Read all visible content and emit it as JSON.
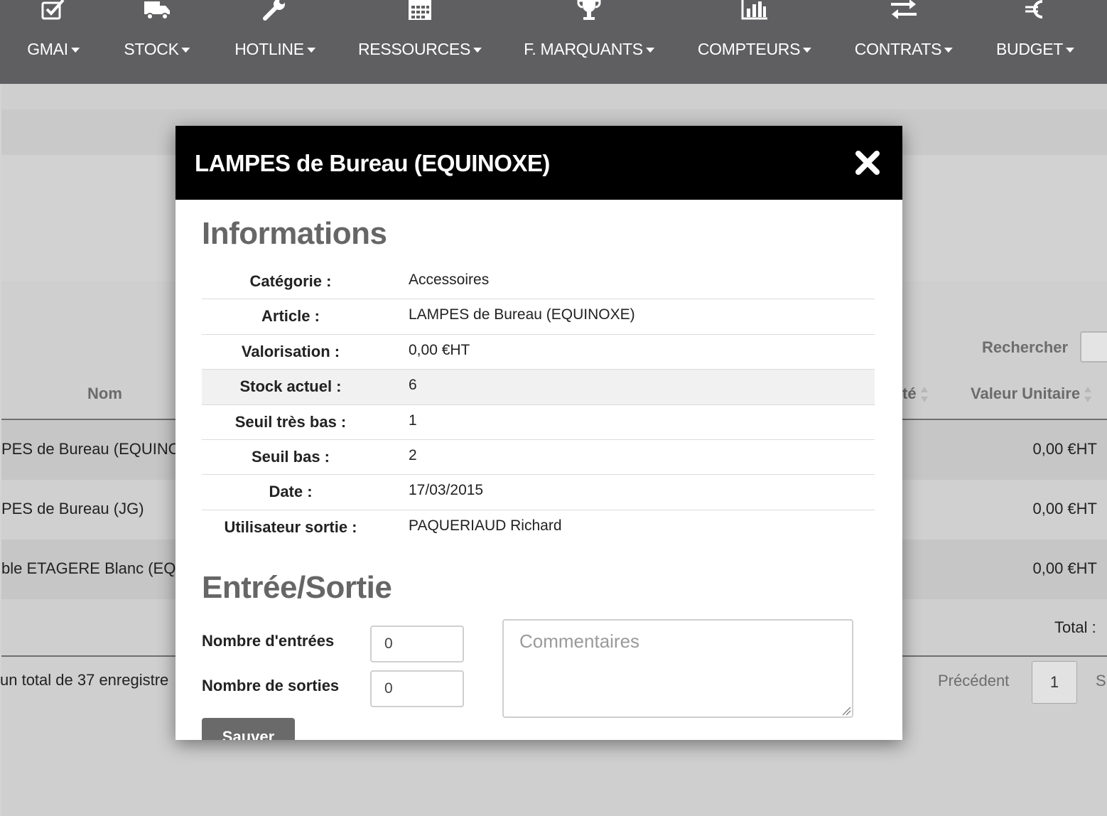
{
  "nav": {
    "items": [
      {
        "label": "GMAI",
        "icon": "checkbox-icon"
      },
      {
        "label": "STOCK",
        "icon": "truck-icon"
      },
      {
        "label": "HOTLINE",
        "icon": "wrench-icon"
      },
      {
        "label": "RESSOURCES",
        "icon": "calendar-icon"
      },
      {
        "label": "F. MARQUANTS",
        "icon": "trophy-icon"
      },
      {
        "label": "COMPTEURS",
        "icon": "bar-chart-icon"
      },
      {
        "label": "CONTRATS",
        "icon": "exchange-icon"
      },
      {
        "label": "BUDGET",
        "icon": "euro-icon"
      }
    ]
  },
  "background": {
    "search_label": "Rechercher",
    "columns": {
      "nom": "Nom",
      "qte_partial": "té",
      "valeur_unitaire": "Valeur Unitaire"
    },
    "rows": [
      {
        "name": "PES de Bureau (EQUINO",
        "value": "0,00 €HT"
      },
      {
        "name": "PES de Bureau (JG)",
        "value": "0,00 €HT"
      },
      {
        "name": "ble ETAGERE Blanc (EQU",
        "value": "0,00 €HT"
      }
    ],
    "total_label": "Total :",
    "footer_text": "un total de 37 enregistre",
    "pagination": {
      "previous": "Précédent",
      "current_page": "1",
      "next_partial": "S"
    }
  },
  "modal": {
    "title": "LAMPES de Bureau (EQUINOXE)",
    "close_glyph": "✖",
    "info_section_title": "Informations",
    "info": [
      {
        "label": "Catégorie :",
        "value": "Accessoires"
      },
      {
        "label": "Article :",
        "value": "LAMPES de Bureau (EQUINOXE)"
      },
      {
        "label": "Valorisation :",
        "value": "0,00 €HT"
      },
      {
        "label": "Stock actuel :",
        "value": "6"
      },
      {
        "label": "Seuil très bas :",
        "value": "1"
      },
      {
        "label": "Seuil bas :",
        "value": "2"
      },
      {
        "label": "Date :",
        "value": "17/03/2015"
      },
      {
        "label": "Utilisateur sortie :",
        "value": "PAQUERIAUD Richard"
      }
    ],
    "io_section_title": "Entrée/Sortie",
    "entries_label": "Nombre d'entrées",
    "entries_value": "0",
    "exits_label": "Nombre de sorties",
    "exits_value": "0",
    "comment_placeholder": "Commentaires",
    "save_label": "Sauver"
  },
  "colors": {
    "nav_bg": "#5f5f61",
    "modal_header_bg": "#000000",
    "page_bg": "#cfcfcf",
    "save_button_bg": "#6a6a6a"
  }
}
